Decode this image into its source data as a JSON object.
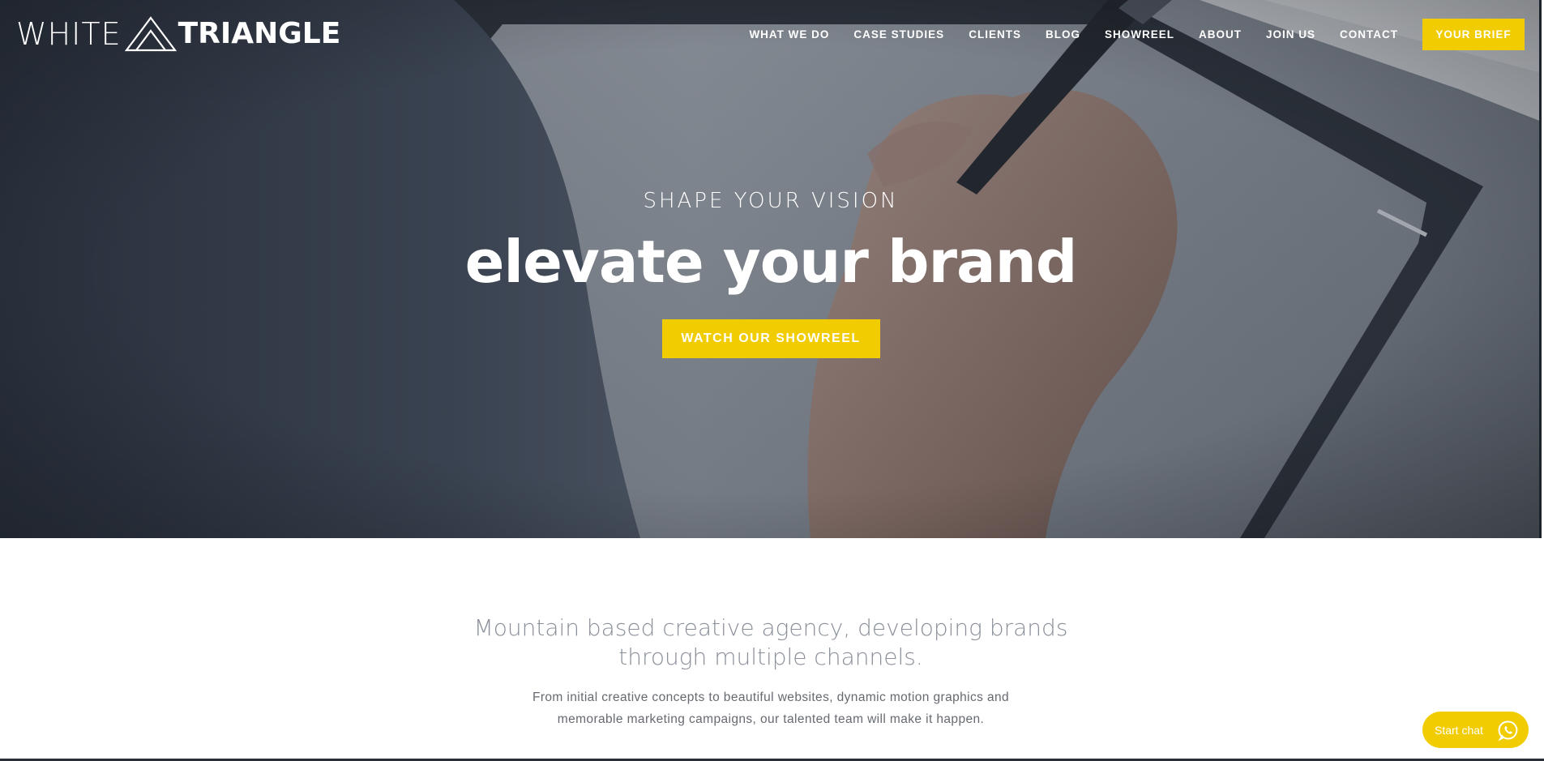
{
  "brand": {
    "logo_word1": "WHITE",
    "logo_word2": "TRIANGLE",
    "accent_color": "#f0cc00"
  },
  "nav": {
    "items": [
      {
        "label": "WHAT WE DO"
      },
      {
        "label": "CASE STUDIES"
      },
      {
        "label": "CLIENTS"
      },
      {
        "label": "BLOG"
      },
      {
        "label": "SHOWREEL"
      },
      {
        "label": "ABOUT"
      },
      {
        "label": "JOIN US"
      },
      {
        "label": "CONTACT"
      }
    ],
    "cta_label": "YOUR BRIEF"
  },
  "hero": {
    "kicker": "SHAPE YOUR VISION",
    "title": "elevate your brand",
    "button_label": "WATCH OUR SHOWREEL"
  },
  "intro": {
    "heading_line1": "Mountain based creative agency, developing brands",
    "heading_line2": "through multiple channels.",
    "body_line1": "From initial creative concepts to beautiful websites, dynamic motion graphics and",
    "body_line2": "memorable marketing campaigns, our talented team will make it happen."
  },
  "chat": {
    "label": "Start chat",
    "icon": "whatsapp-icon"
  }
}
